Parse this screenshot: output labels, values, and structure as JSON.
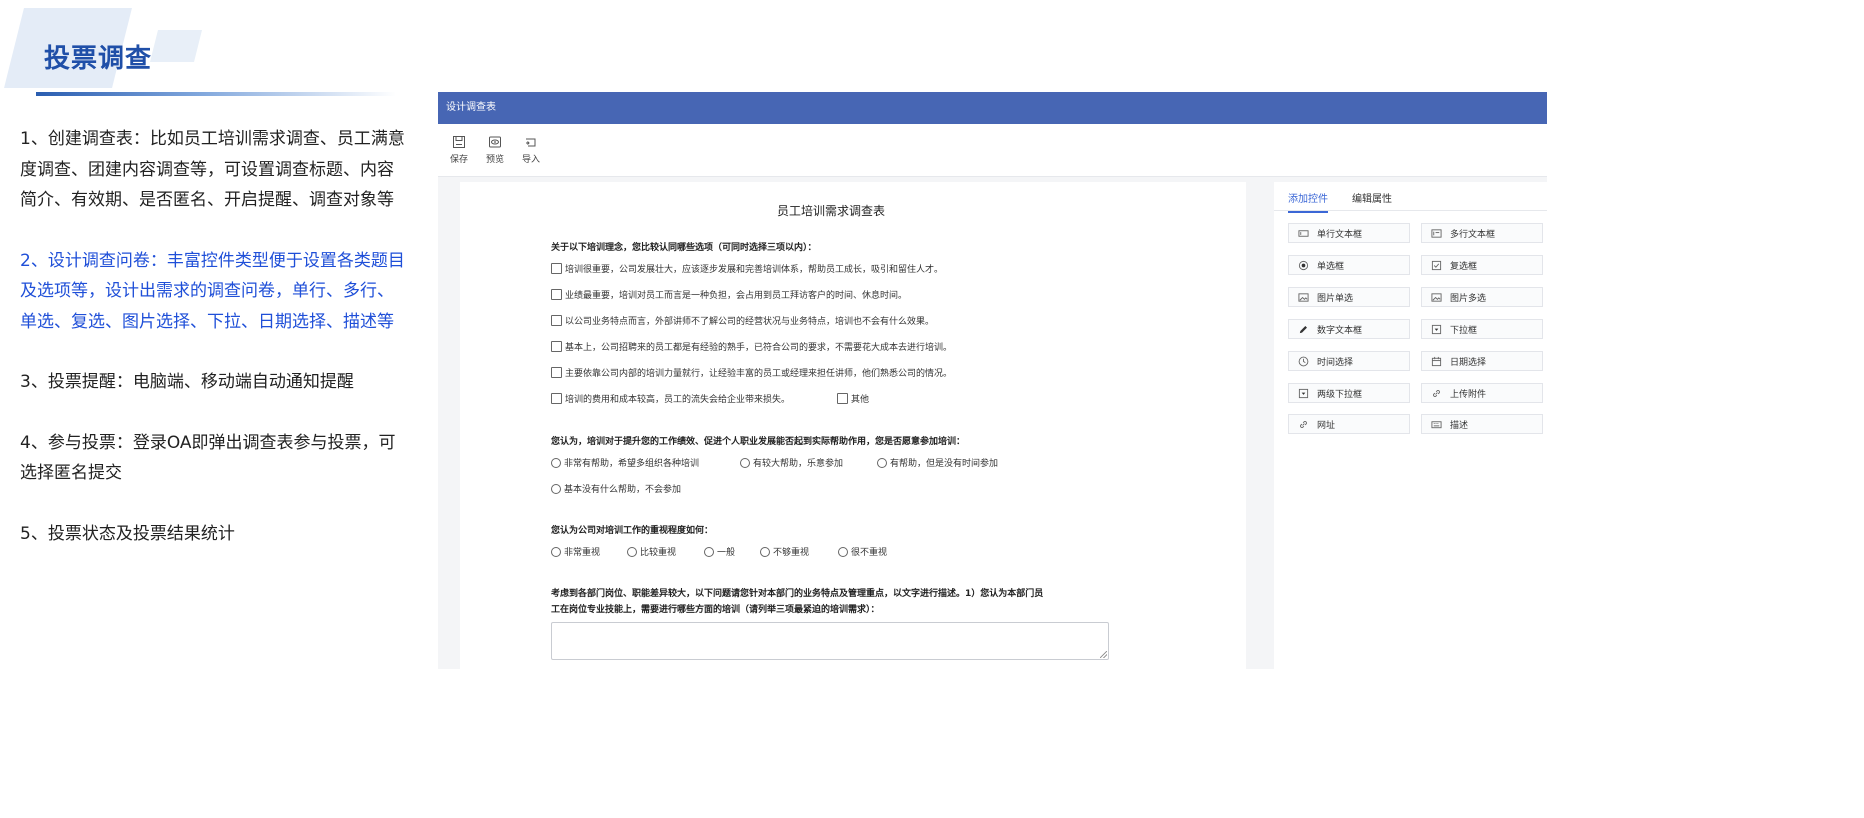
{
  "slide": {
    "title": "投票调查",
    "points": [
      "1、创建调查表：比如员工培训需求调查、员工满意度调查、团建内容调查等，可设置调查标题、内容简介、有效期、是否匿名、开启提醒、调查对象等",
      "2、设计调查问卷：丰富控件类型便于设置各类题目及选项等，设计出需求的调查问卷，单行、多行、单选、复选、图片选择、下拉、日期选择、描述等",
      "3、投票提醒：电脑端、移动端自动通知提醒",
      "4、参与投票：登录OA即弹出调查表参与投票，可选择匿名提交",
      "5、投票状态及投票结果统计"
    ]
  },
  "app": {
    "header_title": "设计调查表",
    "toolbar": {
      "save": "保存",
      "preview": "预览",
      "import": "导入"
    }
  },
  "form": {
    "title": "员工培训需求调查表",
    "q1": {
      "text": "关于以下培训理念，您比较认同哪些选项（可同时选择三项以内）：",
      "options": [
        "培训很重要，公司发展壮大，应该逐步发展和完善培训体系，帮助员工成长，吸引和留住人才。",
        "业绩最重要，培训对员工而言是一种负担，会占用到员工拜访客户的时间、休息时间。",
        "以公司业务特点而言，外部讲师不了解公司的经营状况与业务特点，培训也不会有什么效果。",
        "基本上，公司招聘来的员工都是有经验的熟手，已符合公司的要求，不需要花大成本去进行培训。",
        "主要依靠公司内部的培训力量就行，让经验丰富的员工或经理来担任讲师，他们熟悉公司的情况。",
        "培训的费用和成本较高，员工的流失会给企业带来损失。"
      ],
      "other": "其他"
    },
    "q2": {
      "text": "您认为，培训对于提升您的工作绩效、促进个人职业发展能否起到实际帮助作用，您是否愿意参加培训：",
      "options": [
        "非常有帮助，希望多组织各种培训",
        "有较大帮助，乐意参加",
        "有帮助，但是没有时间参加",
        "基本没有什么帮助，不会参加"
      ]
    },
    "q3": {
      "text": "您认为公司对培训工作的重视程度如何：",
      "options": [
        "非常重视",
        "比较重视",
        "一般",
        "不够重视",
        "很不重视"
      ]
    },
    "q4": {
      "line1": "考虑到各部门岗位、职能差异较大，以下问题请您针对本部门的业务特点及管理重点，以文字进行描述。1）您认为本部门员",
      "line2": "工在岗位专业技能上，需要进行哪些方面的培训（请列举三项最紧迫的培训需求）："
    }
  },
  "panel": {
    "tabs": [
      "添加控件",
      "编辑属性"
    ],
    "controls": [
      {
        "label": "单行文本框",
        "icon": "single-line-text-icon"
      },
      {
        "label": "多行文本框",
        "icon": "multi-line-text-icon"
      },
      {
        "label": "单选框",
        "icon": "radio-icon"
      },
      {
        "label": "复选框",
        "icon": "checkbox-icon"
      },
      {
        "label": "图片单选",
        "icon": "image-icon"
      },
      {
        "label": "图片多选",
        "icon": "image-icon"
      },
      {
        "label": "数字文本框",
        "icon": "pencil-icon"
      },
      {
        "label": "下拉框",
        "icon": "dropdown-icon"
      },
      {
        "label": "时间选择",
        "icon": "clock-icon"
      },
      {
        "label": "日期选择",
        "icon": "calendar-icon"
      },
      {
        "label": "两级下拉框",
        "icon": "dropdown-icon"
      },
      {
        "label": "上传附件",
        "icon": "link-icon"
      },
      {
        "label": "网址",
        "icon": "link-icon"
      },
      {
        "label": "描述",
        "icon": "keyboard-icon"
      }
    ]
  }
}
